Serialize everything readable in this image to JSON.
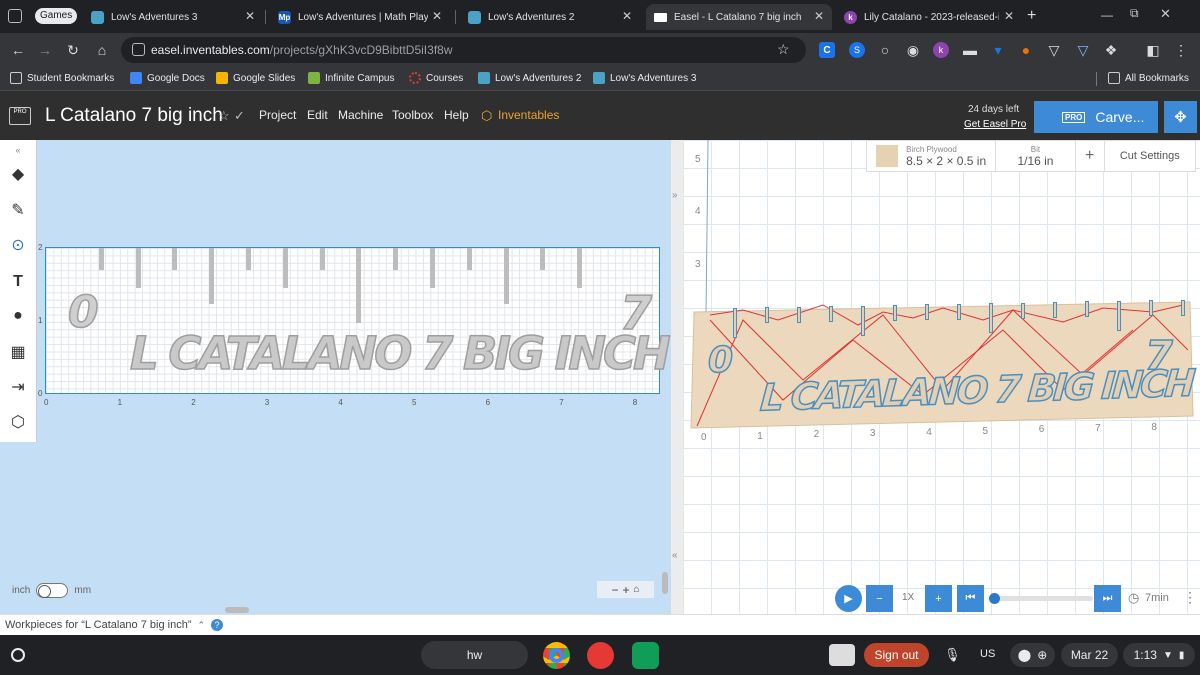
{
  "browser": {
    "games_label": "Games",
    "tabs": [
      {
        "label": "Low's Adventures 3",
        "icon": "game-icon"
      },
      {
        "label": "Low's Adventures | Math Playg",
        "icon": "math-playground-icon"
      },
      {
        "label": "Low's Adventures 2",
        "icon": "game-icon"
      },
      {
        "label": "Easel - L Catalano 7 big inch",
        "icon": "easel-icon",
        "active": true
      },
      {
        "label": "Lily Catalano - 2023-released-it",
        "icon": "kami-icon"
      }
    ],
    "new_tab": "+",
    "url_host": "easel.inventables.com",
    "url_path": "/projects/gXhK3vcD9BibttD5iI3f8w",
    "bookmarks": [
      {
        "label": "Student Bookmarks",
        "icon": "folder-icon"
      },
      {
        "label": "Google Docs",
        "icon": "google-docs-icon"
      },
      {
        "label": "Google Slides",
        "icon": "google-slides-icon"
      },
      {
        "label": "Infinite Campus",
        "icon": "infinite-campus-icon"
      },
      {
        "label": "Courses",
        "icon": "courses-icon"
      },
      {
        "label": "Low's Adventures 2",
        "icon": "game-icon"
      },
      {
        "label": "Low's Adventures 3",
        "icon": "game-icon"
      }
    ],
    "all_bookmarks": "All Bookmarks"
  },
  "easel": {
    "pro_badge": "PRO",
    "project_title": "L Catalano 7 big inch",
    "menus": [
      "Project",
      "Edit",
      "Machine",
      "Toolbox",
      "Help"
    ],
    "inventables": "Inventables",
    "trial_days": "24 days left",
    "get_pro": "Get Easel Pro",
    "carve_pro": "PRO",
    "carve_label": "Carve...",
    "design_text": "L CATALANO 7 BIG INCH",
    "digit_left": "0",
    "digit_right": "7",
    "design_x_ticks": [
      "0",
      "1",
      "2",
      "3",
      "4",
      "5",
      "6",
      "7",
      "8"
    ],
    "design_y_ticks": [
      "0",
      "1",
      "2"
    ],
    "unit_left": "inch",
    "unit_right": "mm",
    "material_name": "Birch Plywood",
    "material_size": "8.5 × 2 × 0.5 in",
    "bit_label": "Bit",
    "bit_value": "1/16 in",
    "add_symbol": "+",
    "cut_settings": "Cut Settings",
    "preview_x_ticks": [
      "0",
      "1",
      "2",
      "3",
      "4",
      "5",
      "6",
      "7",
      "8"
    ],
    "preview_y_ticks": [
      "3",
      "4",
      "5"
    ],
    "speed": "1X",
    "time": "7min",
    "workpieces": "Workpieces for “L Catalano 7 big inch”",
    "help_q": "?"
  },
  "shelf": {
    "search": "hw",
    "sign_out": "Sign out",
    "ime": "US",
    "date": "Mar 22",
    "time": "1:13"
  }
}
